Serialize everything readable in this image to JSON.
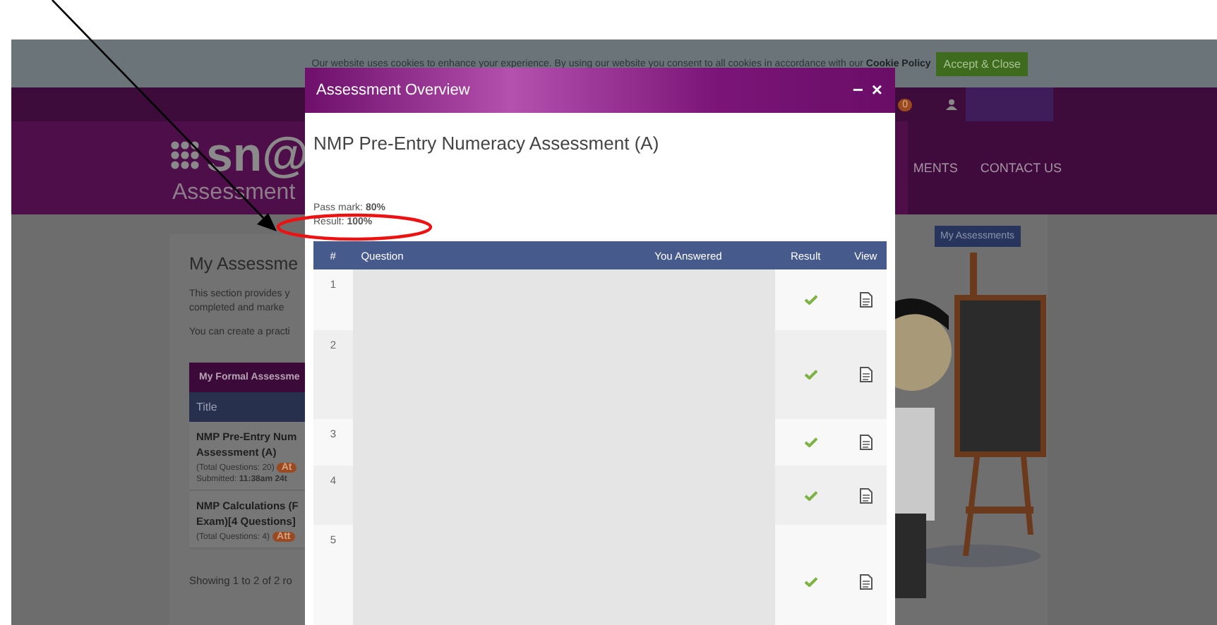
{
  "cookie_bar": {
    "message": "Our website uses cookies to enhance your experience. By using our website you consent to all cookies in accordance with our",
    "link": "Cookie Policy",
    "button": "Accept & Close"
  },
  "top_bar": {
    "notification_count": "0"
  },
  "header": {
    "logo": "sn@",
    "subtitle": "Assessment",
    "nav": [
      "MENTS",
      "CONTACT US"
    ]
  },
  "page": {
    "title": "My Assessme",
    "paragraphs": [
      "This section provides y",
      "completed and marke",
      "You can create a practi"
    ],
    "my_assessments_button": "My Assessments",
    "table": {
      "title": "My Formal Assessme",
      "column": "Title",
      "rows": [
        {
          "lines": [
            "NMP Pre-Entry Num",
            "Assessment (A)"
          ],
          "total": "(Total Questions: 20)",
          "badge": "At",
          "submitted_label": "Submitted:",
          "submitted": "11:38am 24t"
        },
        {
          "lines": [
            "NMP Calculations (F",
            "Exam)[4 Questions]"
          ],
          "total": "(Total Questions: 4)",
          "badge": "Att"
        }
      ]
    },
    "footer": "Showing 1 to 2 of 2 ro"
  },
  "modal": {
    "title": "Assessment Overview",
    "minimize": "−",
    "close": "×",
    "heading": "NMP Pre-Entry Numeracy Assessment (A)",
    "pass_mark_label": "Pass mark:",
    "pass_mark": "80%",
    "result_label": "Result:",
    "result": "100%",
    "columns": [
      "#",
      "Question",
      "You Answered",
      "Result",
      "View"
    ],
    "rows": [
      {
        "number": "1",
        "correct": true
      },
      {
        "number": "2",
        "correct": true
      },
      {
        "number": "3",
        "correct": true
      },
      {
        "number": "4",
        "correct": true
      },
      {
        "number": "5",
        "correct": true
      }
    ]
  }
}
